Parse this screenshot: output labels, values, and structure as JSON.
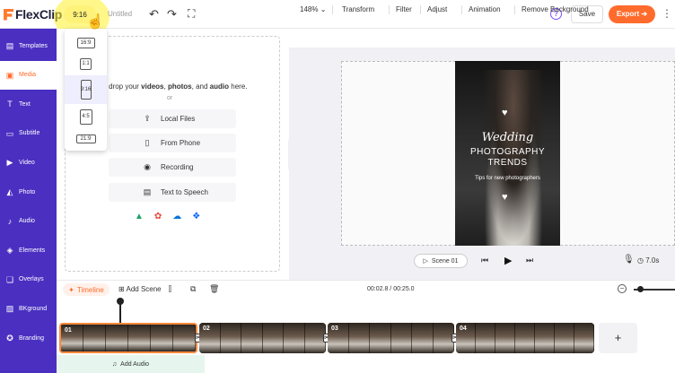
{
  "app": {
    "logo_text": "FlexClip",
    "title": "Untitled"
  },
  "topbar": {
    "ratio_label": "9:16",
    "undo_icon": "undo-icon",
    "redo_icon": "redo-icon",
    "fullscreen_icon": "fullscreen-icon",
    "help_symbol": "?",
    "save_label": "Save",
    "export_label": "Export ➔"
  },
  "ratio_menu": {
    "options": [
      {
        "label": "16:9",
        "selected": false
      },
      {
        "label": "1:1",
        "selected": false
      },
      {
        "label": "9:16",
        "selected": true
      },
      {
        "label": "4:5",
        "selected": false
      },
      {
        "label": "21:9",
        "selected": false
      }
    ]
  },
  "sidebar": {
    "items": [
      {
        "label": "Templates",
        "icon": "templates-icon"
      },
      {
        "label": "Media",
        "icon": "media-icon",
        "active": true
      },
      {
        "label": "Text",
        "icon": "text-icon"
      },
      {
        "label": "Subtitle",
        "icon": "subtitle-icon"
      },
      {
        "label": "Video",
        "icon": "video-icon"
      },
      {
        "label": "Photo",
        "icon": "photo-icon"
      },
      {
        "label": "Audio",
        "icon": "audio-icon"
      },
      {
        "label": "Elements",
        "icon": "elements-icon"
      },
      {
        "label": "Overlays",
        "icon": "overlays-icon"
      },
      {
        "label": "BKground",
        "icon": "background-icon"
      },
      {
        "label": "Branding",
        "icon": "branding-icon"
      }
    ]
  },
  "media": {
    "drop_prefix": "nd drop your",
    "drop_videos": "videos",
    "drop_sep1": ",",
    "drop_photos": "photos",
    "drop_sep2": ", and",
    "drop_audio": "audio",
    "drop_suffix": "here.",
    "or": "or",
    "buttons": [
      {
        "label": "Local Files",
        "icon": "upload-icon"
      },
      {
        "label": "From Phone",
        "icon": "phone-icon"
      },
      {
        "label": "Recording",
        "icon": "record-icon"
      },
      {
        "label": "Text to Speech",
        "icon": "speech-icon"
      }
    ],
    "cloud_sources": [
      "google-drive-icon",
      "google-photos-icon",
      "onedrive-icon",
      "dropbox-icon"
    ]
  },
  "edit_toolbar": {
    "zoom": "148%",
    "items": [
      "Transform",
      "Filter",
      "Adjust",
      "Animation",
      "Remove Background"
    ]
  },
  "poster": {
    "script_title": "Wedding",
    "line1": "PHOTOGRAPHY",
    "line2": "TRENDS",
    "tagline": "Tips for new photographers"
  },
  "playbar": {
    "scene_label": "Scene 01",
    "duration": "7.0s"
  },
  "timeline": {
    "label": "Timeline",
    "add_scene": "Add Scene",
    "time_readout": "00:02.8 / 00:25.0",
    "clips": [
      {
        "num": "01",
        "selected": true
      },
      {
        "num": "02",
        "selected": false
      },
      {
        "num": "03",
        "selected": false
      },
      {
        "num": "04",
        "selected": false
      }
    ],
    "add_clip_symbol": "+",
    "add_audio": "Add Audio"
  },
  "colors": {
    "accent": "#ff6b2c",
    "sidebar": "#4a2fc1",
    "highlight": "#fff27a"
  }
}
